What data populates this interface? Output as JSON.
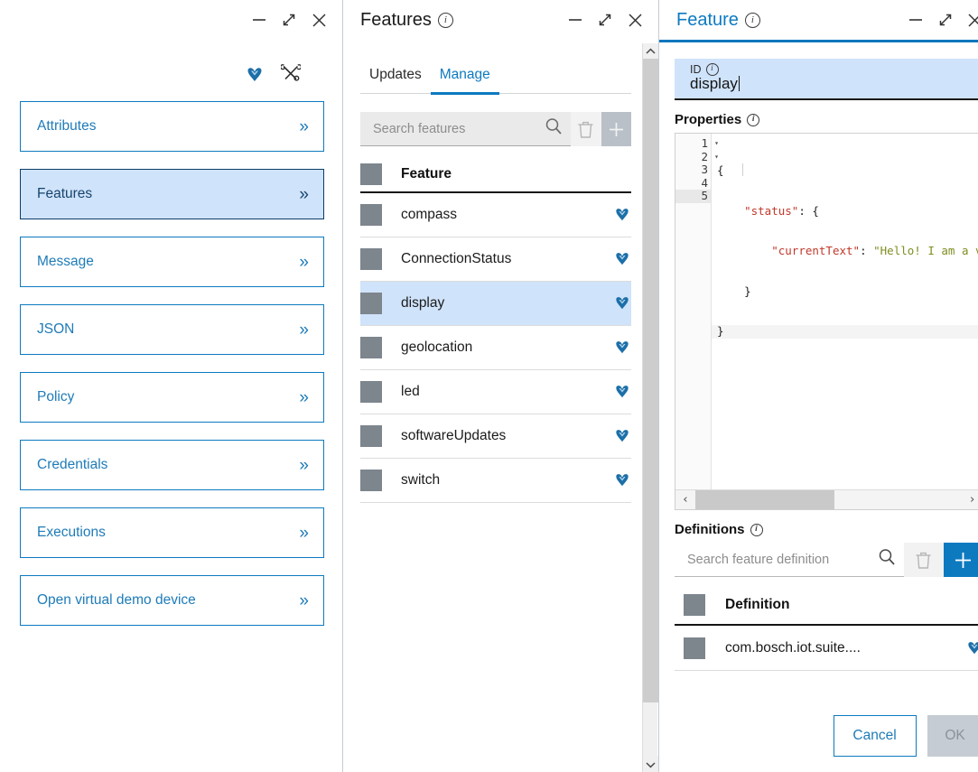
{
  "left_panel": {
    "window_controls": [
      "minimize",
      "expand",
      "close"
    ],
    "tools": [
      {
        "icon": "bosch-heart-icon",
        "name": "heart-icon"
      },
      {
        "icon": "tools-icon",
        "name": "tools-icon"
      }
    ],
    "nav_items": [
      {
        "label": "Attributes",
        "selected": false
      },
      {
        "label": "Features",
        "selected": true
      },
      {
        "label": "Message",
        "selected": false
      },
      {
        "label": "JSON",
        "selected": false
      },
      {
        "label": "Policy",
        "selected": false
      },
      {
        "label": "Credentials",
        "selected": false
      },
      {
        "label": "Executions",
        "selected": false
      },
      {
        "label": "Open virtual demo device",
        "selected": false
      }
    ],
    "chevron": "»"
  },
  "mid_panel": {
    "title": "Features",
    "tabs": [
      {
        "label": "Updates",
        "active": false
      },
      {
        "label": "Manage",
        "active": true
      }
    ],
    "search": {
      "placeholder": "Search features",
      "value": ""
    },
    "table": {
      "header": "Feature",
      "rows": [
        {
          "name": "compass"
        },
        {
          "name": "ConnectionStatus"
        },
        {
          "name": "display"
        },
        {
          "name": "geolocation"
        },
        {
          "name": "led"
        },
        {
          "name": "softwareUpdates"
        },
        {
          "name": "switch"
        }
      ],
      "selected_row": "display"
    }
  },
  "right_panel": {
    "title": "Feature",
    "id_field": {
      "label": "ID",
      "value": "display"
    },
    "properties_label": "Properties",
    "editor": {
      "lines": [
        {
          "no": "1",
          "fold": true,
          "text": "{"
        },
        {
          "no": "2",
          "fold": true,
          "text": "    \"status\": {"
        },
        {
          "no": "3",
          "fold": false,
          "text": "        \"currentText\": \"Hello! I am a v"
        },
        {
          "no": "4",
          "fold": false,
          "text": "    }"
        },
        {
          "no": "5",
          "fold": false,
          "text": "}"
        }
      ],
      "active_line": "5",
      "tokens": {
        "status_key": "\"status\"",
        "current_text_key": "\"currentText\"",
        "current_text_value": "\"Hello! I am a v"
      }
    },
    "definitions_label": "Definitions",
    "definitions_search": {
      "placeholder": "Search feature definition",
      "value": ""
    },
    "definitions_table": {
      "header": "Definition",
      "rows": [
        {
          "name": "com.bosch.iot.suite...."
        }
      ]
    },
    "buttons": {
      "cancel": "Cancel",
      "ok": "OK"
    }
  },
  "colors": {
    "accent_blue": "#0d7ac0",
    "link_blue": "#1e7bb8",
    "selection_blue": "#cfe3fa",
    "selected_border": "#0b3c6b",
    "grey_square": "#7d858d",
    "code_key": "#c0392b",
    "code_string": "#7f8c1f"
  }
}
